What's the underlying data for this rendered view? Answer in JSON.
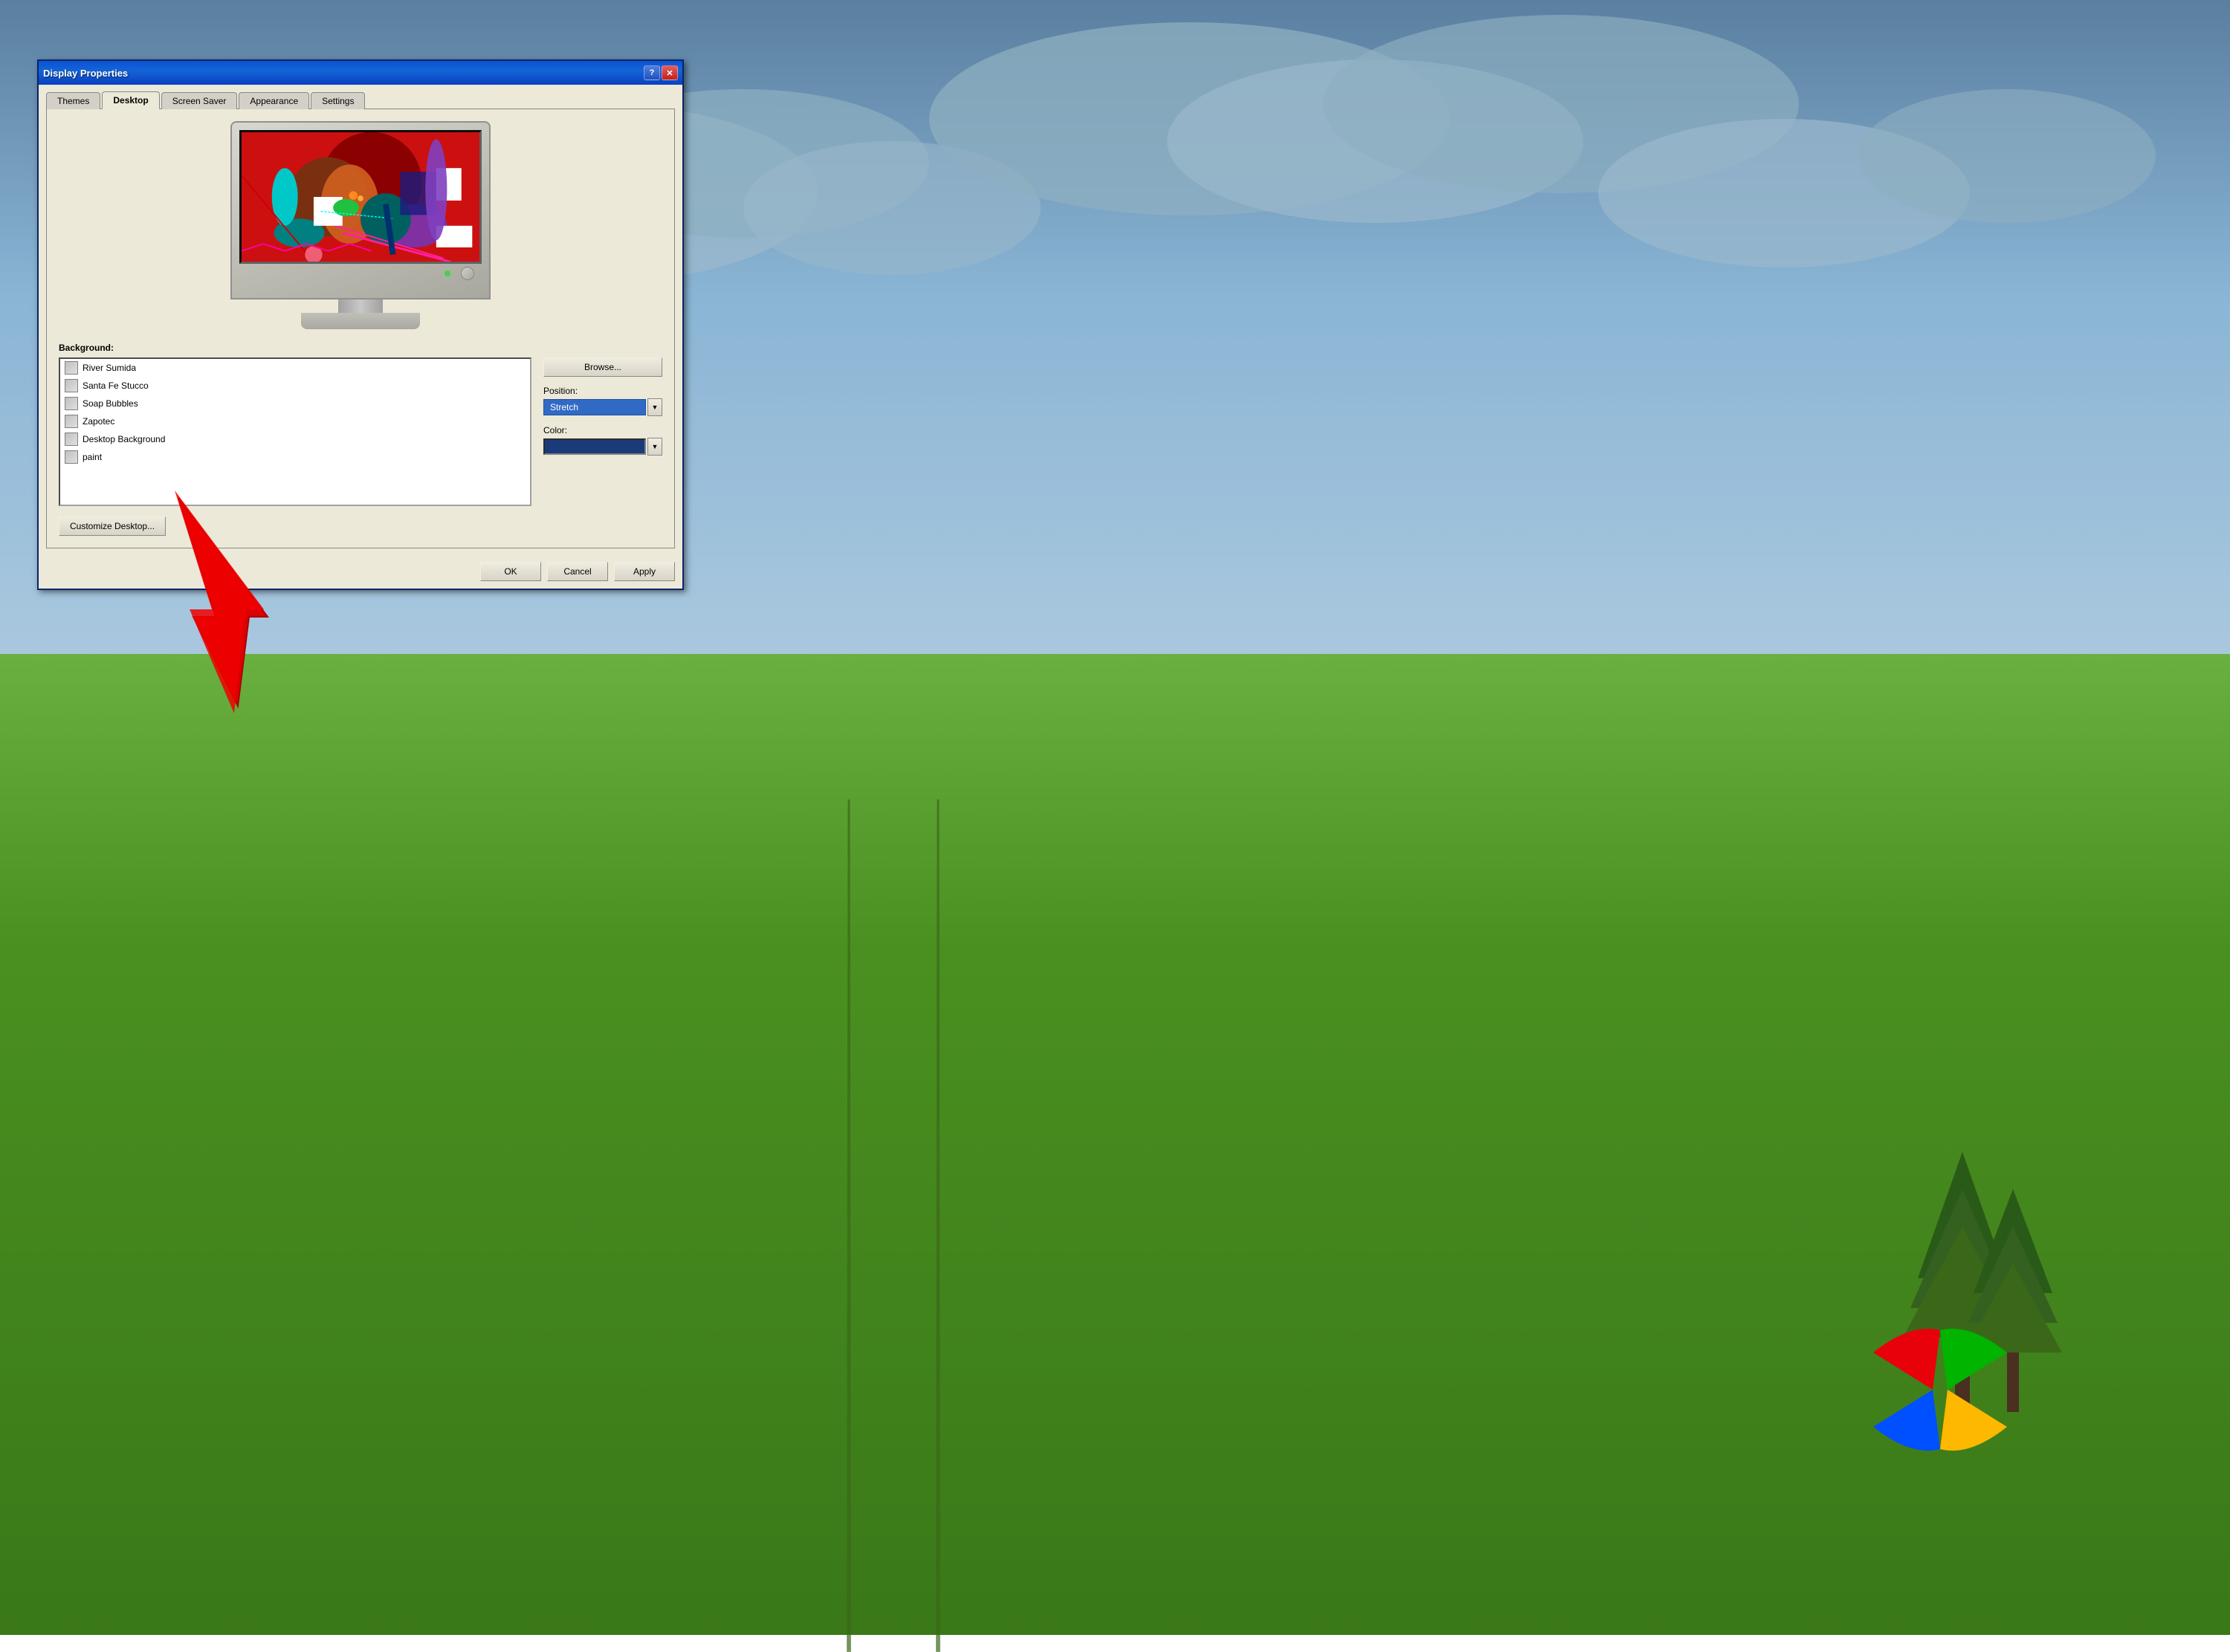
{
  "window": {
    "title": "Display Properties",
    "help_btn": "?",
    "close_btn": "✕"
  },
  "tabs": [
    {
      "id": "themes",
      "label": "Themes",
      "active": false
    },
    {
      "id": "desktop",
      "label": "Desktop",
      "active": true
    },
    {
      "id": "screen-saver",
      "label": "Screen Saver",
      "active": false
    },
    {
      "id": "appearance",
      "label": "Appearance",
      "active": false
    },
    {
      "id": "settings",
      "label": "Settings",
      "active": false
    }
  ],
  "background": {
    "label": "Background:",
    "items": [
      {
        "name": "River Sumida"
      },
      {
        "name": "Santa Fe Stucco"
      },
      {
        "name": "Soap Bubbles"
      },
      {
        "name": "Zapotec"
      },
      {
        "name": "Desktop Background"
      },
      {
        "name": "paint"
      }
    ],
    "browse_label": "Browse...",
    "position_label": "Position:",
    "position_value": "Stretch",
    "color_label": "Color:",
    "customize_label": "Customize Desktop..."
  },
  "bottom_buttons": {
    "ok": "OK",
    "cancel": "Cancel",
    "apply": "Apply"
  }
}
